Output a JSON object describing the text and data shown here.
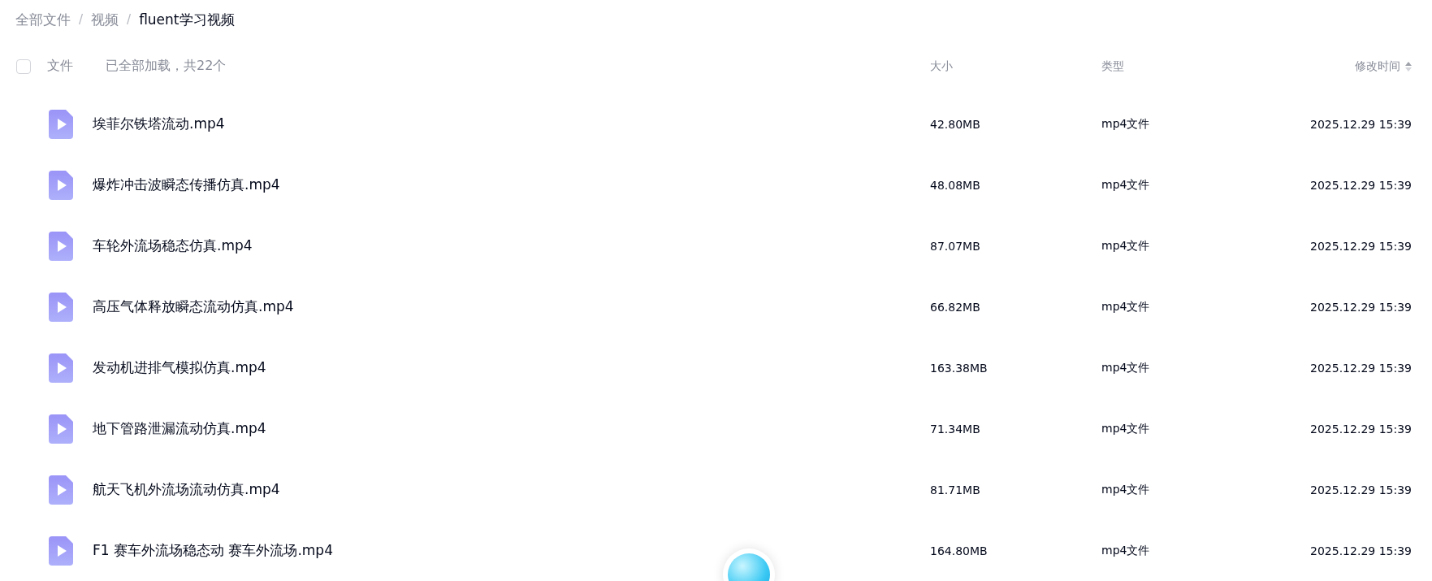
{
  "breadcrumb": [
    {
      "label": "全部文件",
      "current": false
    },
    {
      "label": "视频",
      "current": false
    },
    {
      "label": "fluent学习视频",
      "current": true
    }
  ],
  "breadcrumb_separator": "/",
  "table": {
    "select_all": {
      "checked": false
    },
    "columns": [
      "文件",
      "大小",
      "类型",
      "修改时间"
    ],
    "load_status": "已全部加载，共22个",
    "rows": [
      {
        "name": "埃菲尔铁塔流动.mp4",
        "size": "42.80MB",
        "type": "mp4文件",
        "modified": "2025.12.29 15:39"
      },
      {
        "name": "爆炸冲击波瞬态传播仿真.mp4",
        "size": "48.08MB",
        "type": "mp4文件",
        "modified": "2025.12.29 15:39"
      },
      {
        "name": "车轮外流场稳态仿真.mp4",
        "size": "87.07MB",
        "type": "mp4文件",
        "modified": "2025.12.29 15:39"
      },
      {
        "name": "高压气体释放瞬态流动仿真.mp4",
        "size": "66.82MB",
        "type": "mp4文件",
        "modified": "2025.12.29 15:39"
      },
      {
        "name": "发动机进排气模拟仿真.mp4",
        "size": "163.38MB",
        "type": "mp4文件",
        "modified": "2025.12.29 15:39"
      },
      {
        "name": "地下管路泄漏流动仿真.mp4",
        "size": "71.34MB",
        "type": "mp4文件",
        "modified": "2025.12.29 15:39"
      },
      {
        "name": "航天飞机外流场流动仿真.mp4",
        "size": "81.71MB",
        "type": "mp4文件",
        "modified": "2025.12.29 15:39"
      },
      {
        "name": "F1 赛车外流场稳态动 赛车外流场.mp4",
        "size": "164.80MB",
        "type": "mp4文件",
        "modified": "2025.12.29 15:39"
      }
    ]
  }
}
